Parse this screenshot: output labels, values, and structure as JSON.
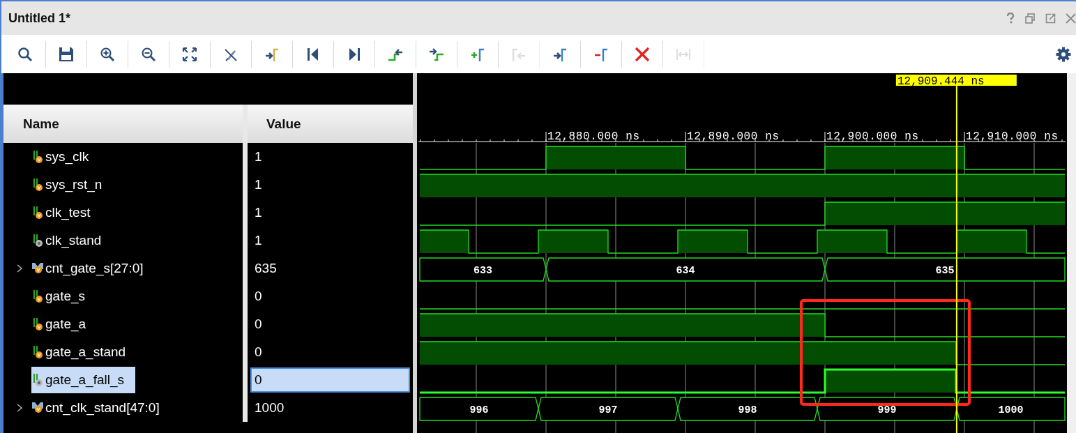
{
  "window": {
    "title": "Untitled 1*"
  },
  "toolbar": [
    {
      "kind": "search",
      "disabled": false
    },
    {
      "kind": "save",
      "disabled": false
    },
    {
      "kind": "zoom-in",
      "disabled": false
    },
    {
      "kind": "zoom-out",
      "disabled": false
    },
    {
      "kind": "zoom-fit",
      "disabled": false
    },
    {
      "kind": "snap",
      "disabled": false
    },
    {
      "kind": "to-cursor",
      "disabled": false
    },
    {
      "kind": "go-start",
      "disabled": false
    },
    {
      "kind": "go-end",
      "disabled": false
    },
    {
      "kind": "prev-transition",
      "disabled": false
    },
    {
      "kind": "next-transition",
      "disabled": false
    },
    {
      "kind": "add-marker",
      "disabled": false
    },
    {
      "kind": "prev-marker",
      "disabled": true
    },
    {
      "kind": "next-marker",
      "disabled": false
    },
    {
      "kind": "delete-marker",
      "disabled": false
    },
    {
      "kind": "delete-all",
      "disabled": false
    },
    {
      "kind": "swap",
      "disabled": true
    }
  ],
  "columns": [
    "Name",
    "Value"
  ],
  "timeline": {
    "cursor": "12,909.444 ns",
    "ticks": [
      "12,880.000 ns",
      "12,890.000 ns",
      "12,900.000 ns",
      "12,910.000 ns"
    ]
  },
  "signals": [
    {
      "name": "sys_clk",
      "kind": "bit",
      "value": "1",
      "selected": false
    },
    {
      "name": "sys_rst_n",
      "kind": "bit",
      "value": "1",
      "selected": false
    },
    {
      "name": "clk_test",
      "kind": "bit",
      "value": "1",
      "selected": false
    },
    {
      "name": "clk_stand",
      "kind": "bit-internal",
      "value": "1",
      "selected": false
    },
    {
      "name": "cnt_gate_s[27:0]",
      "kind": "bus",
      "expanded": false,
      "value": "635",
      "selected": false,
      "wave": [
        "633",
        "634",
        "635"
      ]
    },
    {
      "name": "gate_s",
      "kind": "bit",
      "value": "0",
      "selected": false
    },
    {
      "name": "gate_a",
      "kind": "bit",
      "value": "0",
      "selected": false
    },
    {
      "name": "gate_a_stand",
      "kind": "bit",
      "value": "0",
      "selected": false
    },
    {
      "name": "gate_a_fall_s",
      "kind": "bit-internal",
      "value": "0",
      "selected": true
    },
    {
      "name": "cnt_clk_stand[47:0]",
      "kind": "bus",
      "expanded": false,
      "value": "1000",
      "selected": false,
      "wave": [
        "996",
        "997",
        "998",
        "999",
        "1000"
      ]
    }
  ]
}
